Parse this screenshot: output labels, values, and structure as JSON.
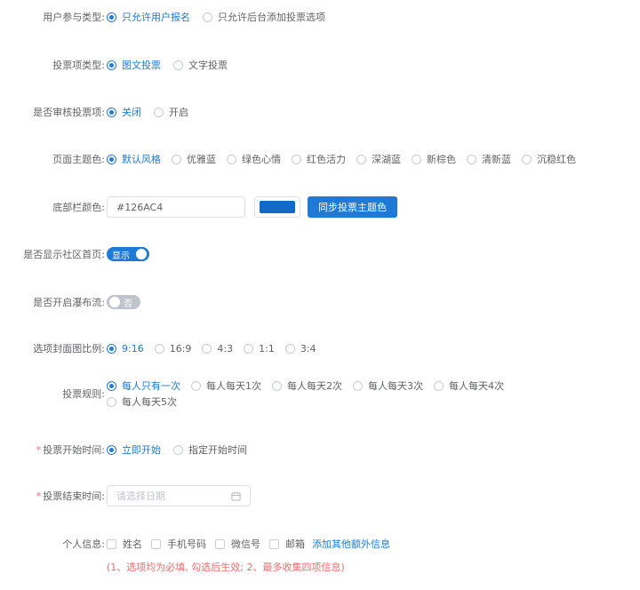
{
  "colors": {
    "accent": "#1e7ad6",
    "required": "#f56c6c",
    "switch_off": "#c0c4cc"
  },
  "user_type": {
    "label": "用户参与类型:",
    "options": [
      "只允许用户报名",
      "只允许后台添加投票选项"
    ],
    "selected": 0
  },
  "item_type": {
    "label": "投票项类型:",
    "options": [
      "图文投票",
      "文字投票"
    ],
    "selected": 0
  },
  "review": {
    "label": "是否审核投票项:",
    "options": [
      "关闭",
      "开启"
    ],
    "selected": 0
  },
  "theme": {
    "label": "页面主题色:",
    "options": [
      "默认风格",
      "优雅蓝",
      "绿色心情",
      "红色活力",
      "深湖蓝",
      "新棕色",
      "清新蓝",
      "沉稳红色"
    ],
    "selected": 0
  },
  "footer_color": {
    "label": "底部栏颜色:",
    "value": "#126AC4",
    "swatch": "#126AC4",
    "button": "同步投票主题色"
  },
  "community": {
    "label": "是否显示社区首页:",
    "state": "显示",
    "on": true
  },
  "waterfall": {
    "label": "是否开启瀑布流:",
    "state": "否",
    "on": false
  },
  "cover_ratio": {
    "label": "选项封面图比例:",
    "options": [
      "9:16",
      "16:9",
      "4:3",
      "1:1",
      "3:4"
    ],
    "selected": 0
  },
  "vote_rule": {
    "label": "投票规则:",
    "options": [
      "每人只有一次",
      "每人每天1次",
      "每人每天2次",
      "每人每天3次",
      "每人每天4次",
      "每人每天5次"
    ],
    "selected": 0
  },
  "start_time": {
    "required_mark": "*",
    "label": "投票开始时间:",
    "options": [
      "立即开始",
      "指定开始时间"
    ],
    "selected": 0
  },
  "end_time": {
    "required_mark": "*",
    "label": "投票结束时间:",
    "placeholder": "请选择日期",
    "icon": "calendar-icon"
  },
  "personal_info": {
    "label": "个人信息:",
    "options": [
      "姓名",
      "手机号码",
      "微信号",
      "邮箱"
    ],
    "add_link": "添加其他额外信息",
    "note": "(1、选项均为必填, 勾选后生效; 2、最多收集四项信息)"
  }
}
